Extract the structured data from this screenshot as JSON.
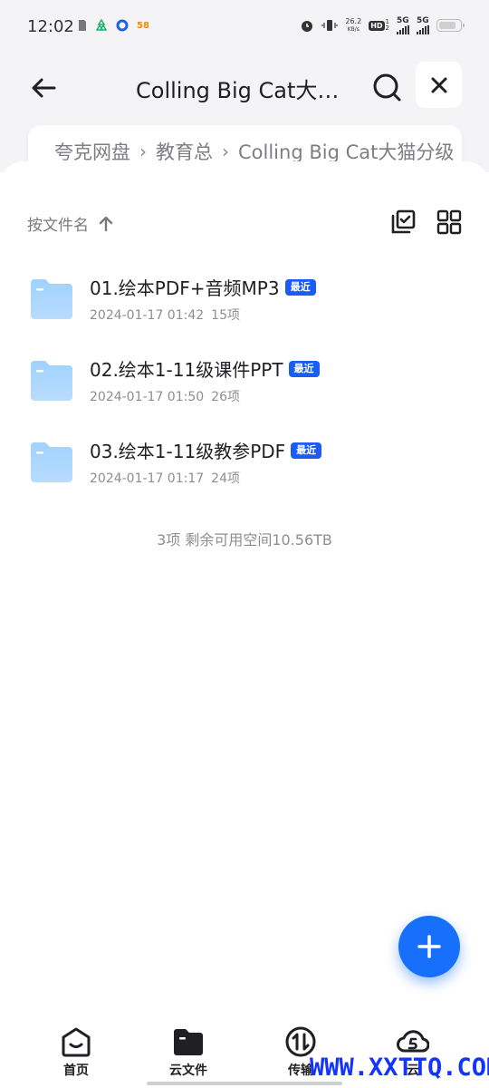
{
  "status_bar": {
    "time": "12:02",
    "app_badge": "58",
    "net_speed_value": "26.2",
    "net_speed_unit": "KB/s",
    "hd_label": "HD",
    "hd_num": "1",
    "hd_num2": "2",
    "sig1_label": "5G",
    "sig2_label": "5G"
  },
  "header": {
    "title": "Colling Big Cat大猫…",
    "breadcrumb": [
      "夸克网盘",
      "教育总",
      "Colling Big Cat大猫分级"
    ]
  },
  "toolbar": {
    "sort_label": "按文件名"
  },
  "files": [
    {
      "name": "01.绘本PDF+音频MP3",
      "badge": "最近",
      "date": "2024-01-17 01:42",
      "count": "15项"
    },
    {
      "name": "02.绘本1-11级课件PPT",
      "badge": "最近",
      "date": "2024-01-17 01:50",
      "count": "26项"
    },
    {
      "name": "03.绘本1-11级教参PDF",
      "badge": "最近",
      "date": "2024-01-17 01:17",
      "count": "24项"
    }
  ],
  "summary": "3项 剩余可用空间10.56TB",
  "bottom_nav": [
    {
      "label": "首页",
      "icon": "home-icon"
    },
    {
      "label": "云文件",
      "icon": "folder-icon"
    },
    {
      "label": "传输",
      "icon": "transfer-icon"
    },
    {
      "label": "云",
      "icon": "cloud-s-icon"
    }
  ],
  "watermark": "WWW.XXTTQ.COM",
  "colors": {
    "accent": "#1670fb",
    "badge": "#1a5cf5",
    "folder": "#8cc8ff",
    "header_bg": "#f4f4f6"
  }
}
